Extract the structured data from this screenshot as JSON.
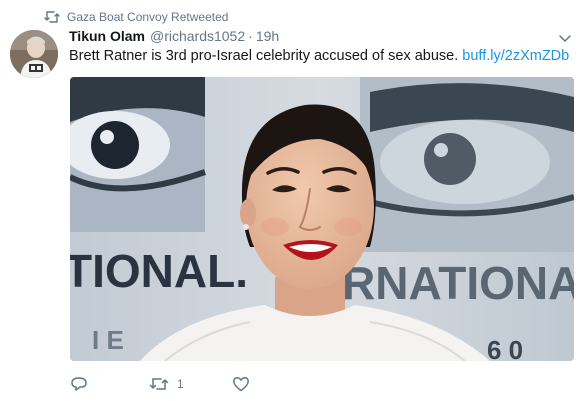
{
  "retweet_header": {
    "text": "Gaza Boat Convoy Retweeted",
    "icon": "retweet-icon"
  },
  "tweet": {
    "display_name": "Tikun Olam",
    "handle": "@richards1052",
    "separator": "·",
    "time": "19h",
    "text": "Brett Ratner is 3rd pro-Israel celebrity accused of sex abuse.",
    "link": "buff.ly/2zXmZDb"
  },
  "media": {
    "backdrop_text_left": "TIONAL.",
    "backdrop_text_right": "RNATIONAL",
    "backdrop_text_bottom_left": "I   E",
    "backdrop_text_bottom_right": "6 0"
  },
  "actions": {
    "reply_icon": "reply-icon",
    "retweet_icon": "retweet-icon",
    "retweet_count": "1",
    "like_icon": "heart-icon"
  },
  "colors": {
    "text_primary": "#14171a",
    "text_secondary": "#657786",
    "link": "#1b95e0"
  }
}
